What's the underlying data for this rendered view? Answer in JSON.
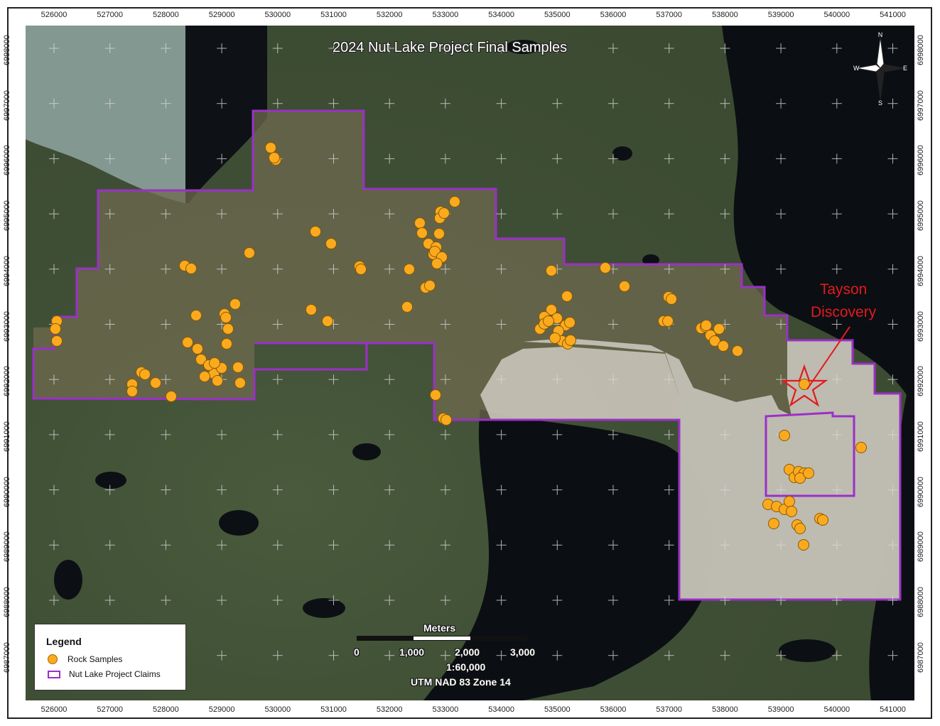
{
  "title": "2024 Nut Lake Project Final Samples",
  "axes": {
    "easting_labels": [
      "526000",
      "527000",
      "528000",
      "529000",
      "530000",
      "531000",
      "532000",
      "533000",
      "534000",
      "535000",
      "536000",
      "537000",
      "538000",
      "539000",
      "540000",
      "541000"
    ],
    "northing_labels": [
      "6998000",
      "6997000",
      "6996000",
      "6995000",
      "6994000",
      "6993000",
      "6992000",
      "6991000",
      "6990000",
      "6989000",
      "6988000",
      "6987000"
    ]
  },
  "north_arrow": {
    "icon": "north-arrow-icon",
    "n": "N",
    "s": "S",
    "e": "E",
    "w": "W"
  },
  "annotation": {
    "line1": "Tayson",
    "line2": "Discovery",
    "color": "#E31A1C"
  },
  "legend": {
    "title": "Legend",
    "items": [
      {
        "label": "Rock Samples",
        "symbol": "orange-circle",
        "color": "#FBAA1E"
      },
      {
        "label": "Nut Lake Project Claims",
        "symbol": "purple-outline",
        "color": "#9B30C7"
      }
    ]
  },
  "scale": {
    "unit_label": "Meters",
    "ticks": [
      "0",
      "1,000",
      "2,000",
      "3,000"
    ],
    "ratio": "1:60,000",
    "projection": "UTM NAD 83 Zone 14"
  },
  "colors": {
    "claims": "#9B30C7",
    "samples": "#FBAA1E",
    "annotation": "#E31A1C",
    "water": "#0b0f13",
    "land": "#45573a"
  }
}
